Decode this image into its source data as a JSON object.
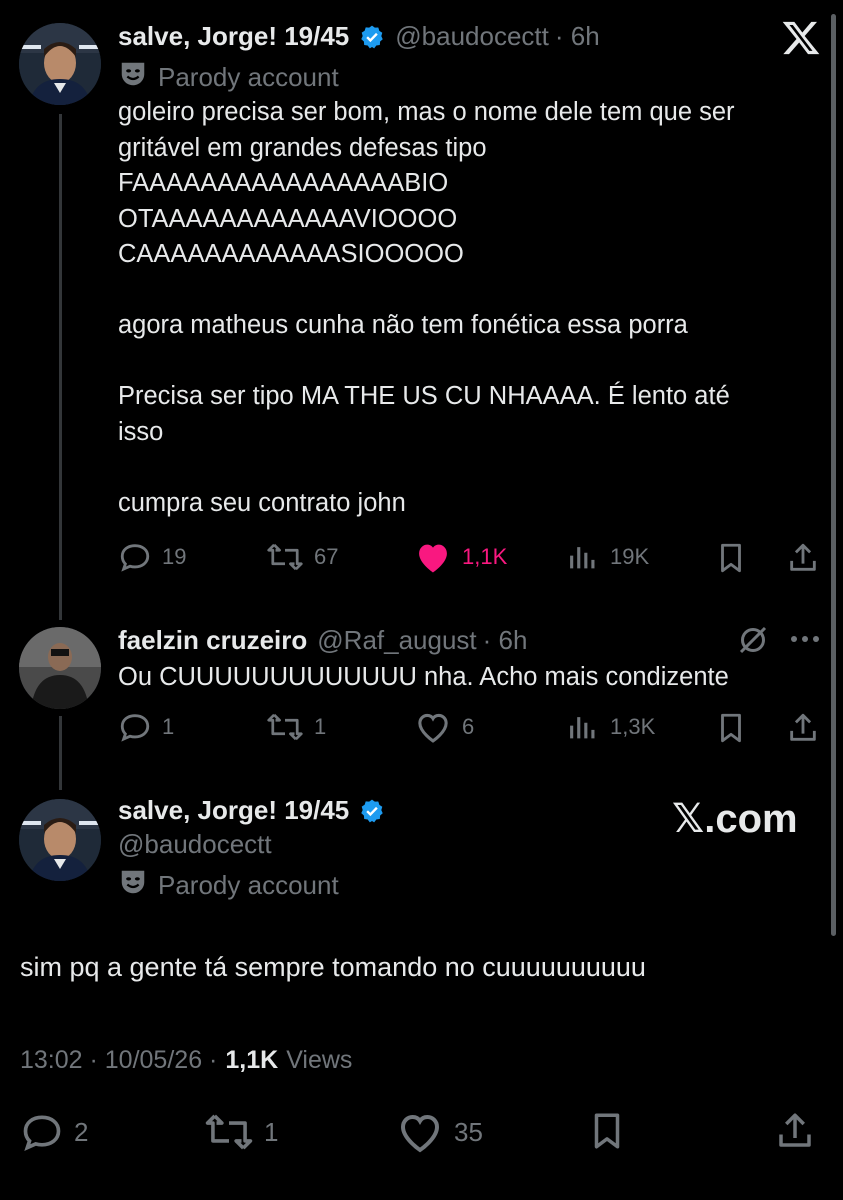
{
  "app": {
    "logo_icon": "x-logo-icon",
    "brand_text": "𝕏.com"
  },
  "colors": {
    "background": "#000000",
    "text": "#e7e9ea",
    "secondary": "#71767b",
    "like_active": "#f91880",
    "verified": "#1d9bf0"
  },
  "tweet1": {
    "name": "salve, Jorge! 19/45",
    "handle": "@baudocectt",
    "time": "· 6h",
    "label": "Parody account",
    "text": "goleiro precisa ser bom, mas o nome dele tem que ser\ngritável em grandes defesas tipo\nFAAAAAAAAAAAAAAAABIO\nOTAAAAAAAAAAAAVIOOOO\nCAAAAAAAAAAAASIOOOOO\n\nagora matheus cunha não tem fonética essa porra\n\nPrecisa ser tipo MA THE US CU NHAAAA. É lento até\nisso\n\ncumpra seu contrato john",
    "replies": "19",
    "reposts": "67",
    "likes": "1,1K",
    "views": "19K"
  },
  "tweet2": {
    "name": "faelzin cruzeiro",
    "handle": "@Raf_august",
    "time": "· 6h",
    "text": "Ou CUUUUUUUUUUUUU nha. Acho mais condizente",
    "replies": "1",
    "reposts": "1",
    "likes": "6",
    "views": "1,3K"
  },
  "tweet3": {
    "name": "salve, Jorge! 19/45",
    "handle": "@baudocectt",
    "label": "Parody account",
    "text": "sim pq a gente tá sempre tomando no cuuuuuuuuuu",
    "timestamp": "13:02 · 10/05/26 ·",
    "views_count": "1,1K",
    "views_label": "Views",
    "replies": "2",
    "reposts": "1",
    "likes": "35"
  }
}
